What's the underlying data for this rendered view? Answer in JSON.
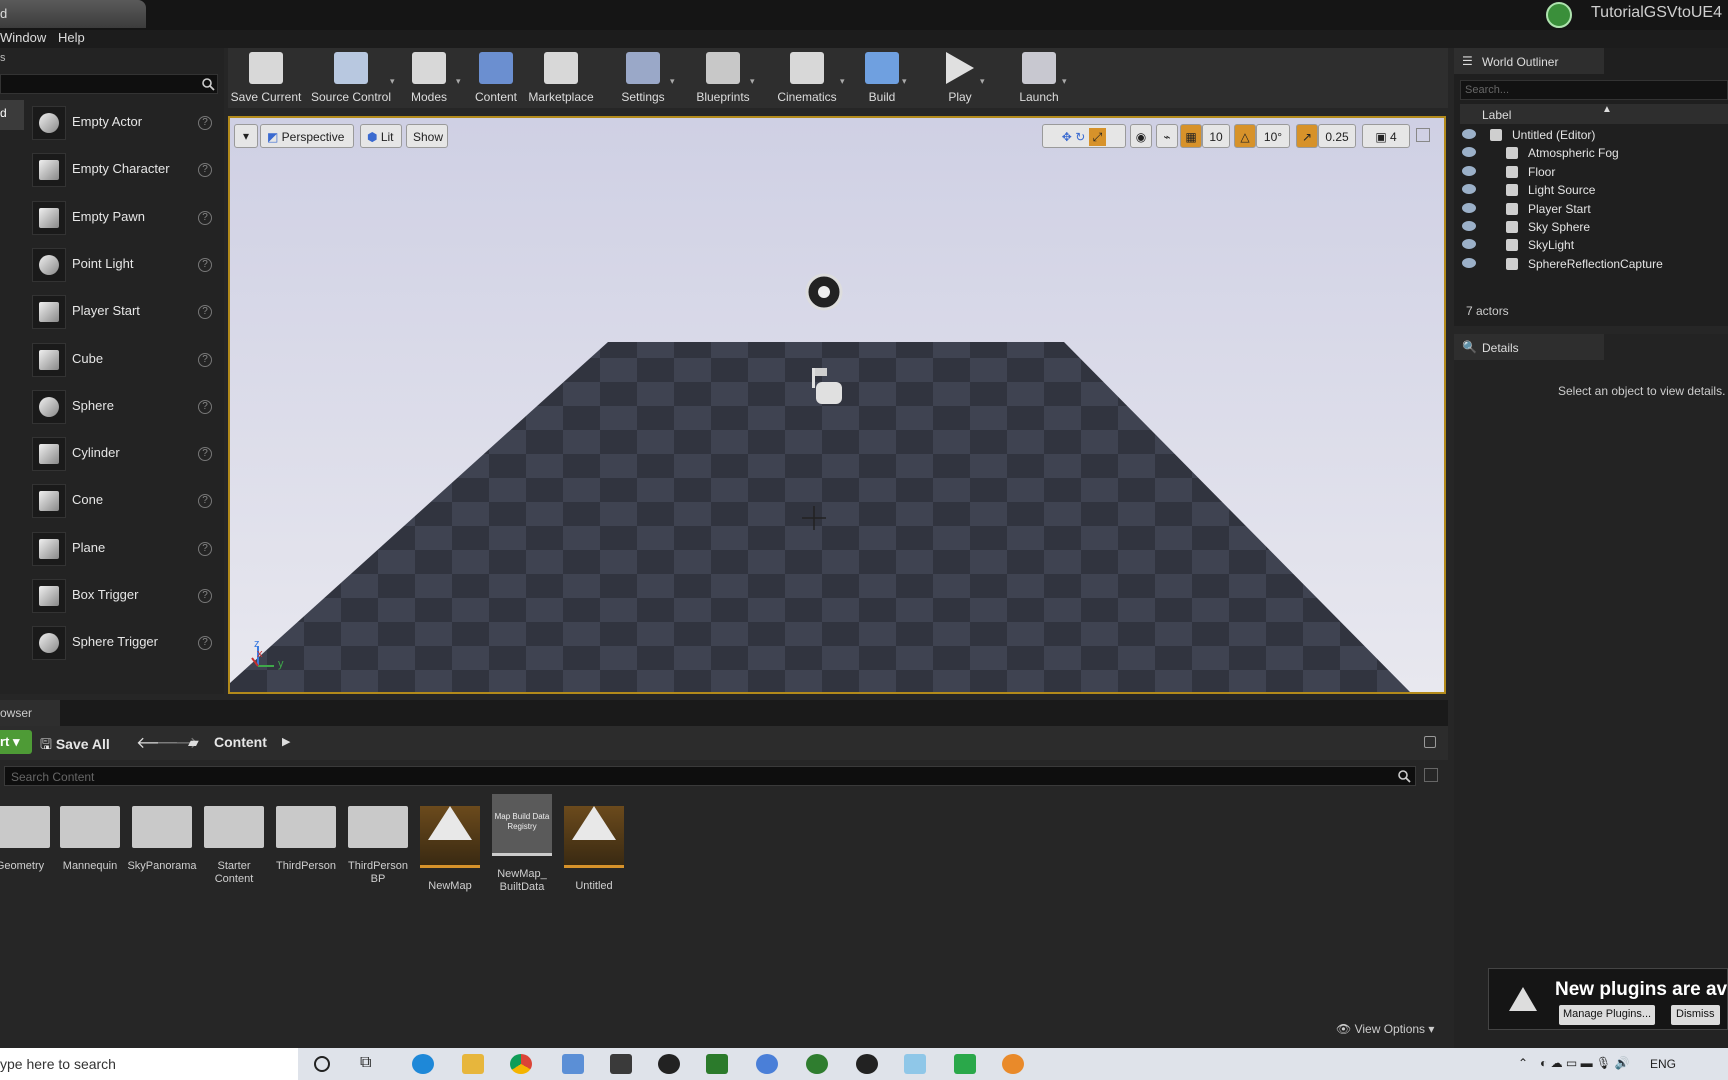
{
  "window": {
    "title_tab": "d",
    "project_name": "TutorialGSVtoUE4"
  },
  "menubar": {
    "items": [
      "Window",
      "Help"
    ]
  },
  "left_panel": {
    "header_fragment": "s",
    "category_fragment": "d",
    "items": [
      {
        "label": "Empty Actor",
        "icon": "empty-actor-icon"
      },
      {
        "label": "Empty Character",
        "icon": "character-icon"
      },
      {
        "label": "Empty Pawn",
        "icon": "pawn-icon"
      },
      {
        "label": "Point Light",
        "icon": "lightbulb-icon"
      },
      {
        "label": "Player Start",
        "icon": "player-start-icon"
      },
      {
        "label": "Cube",
        "icon": "cube-icon"
      },
      {
        "label": "Sphere",
        "icon": "sphere-icon"
      },
      {
        "label": "Cylinder",
        "icon": "cylinder-icon"
      },
      {
        "label": "Cone",
        "icon": "cone-icon"
      },
      {
        "label": "Plane",
        "icon": "plane-icon"
      },
      {
        "label": "Box Trigger",
        "icon": "box-trigger-icon"
      },
      {
        "label": "Sphere Trigger",
        "icon": "sphere-trigger-icon"
      }
    ]
  },
  "toolbar": {
    "buttons": [
      {
        "label": "Save Current",
        "icon": "save-icon"
      },
      {
        "label": "Source Control",
        "icon": "source-control-icon"
      },
      {
        "label": "Modes",
        "icon": "modes-icon"
      },
      {
        "label": "Content",
        "icon": "content-icon"
      },
      {
        "label": "Marketplace",
        "icon": "marketplace-icon"
      },
      {
        "label": "Settings",
        "icon": "settings-icon"
      },
      {
        "label": "Blueprints",
        "icon": "blueprints-icon"
      },
      {
        "label": "Cinematics",
        "icon": "cinematics-icon"
      },
      {
        "label": "Build",
        "icon": "build-icon"
      },
      {
        "label": "Play",
        "icon": "play-icon"
      },
      {
        "label": "Launch",
        "icon": "launch-icon"
      }
    ]
  },
  "viewport": {
    "perspective_label": "Perspective",
    "lit_label": "Lit",
    "show_label": "Show",
    "grid_snap": "10",
    "rotation_snap": "10°",
    "scale_snap": "0.25",
    "camera_speed": "4",
    "axis_z": "z",
    "axis_x": "x",
    "axis_y": "y",
    "accent_color": "#d7922a"
  },
  "content_browser": {
    "tab_label": "owser",
    "import_label": "rt",
    "save_all_label": "Save All",
    "path": "Content",
    "search_placeholder": "Search Content",
    "view_options": "View Options",
    "assets": [
      {
        "name": "Geometry",
        "type": "folder"
      },
      {
        "name": "Mannequin",
        "type": "folder"
      },
      {
        "name": "SkyPanorama",
        "type": "folder"
      },
      {
        "name": "Starter Content",
        "type": "folder"
      },
      {
        "name": "ThirdPerson",
        "type": "folder"
      },
      {
        "name": "ThirdPerson BP",
        "type": "folder"
      },
      {
        "name": "NewMap",
        "type": "map"
      },
      {
        "name": "NewMap_ BuiltData",
        "type": "registry",
        "thumb_text": "Map Build Data Registry"
      },
      {
        "name": "Untitled",
        "type": "map"
      }
    ]
  },
  "outliner": {
    "tab_label": "World Outliner",
    "search_placeholder": "Search...",
    "column_label": "Label",
    "rows": [
      {
        "label": "Untitled (Editor)",
        "indent": 0
      },
      {
        "label": "Atmospheric Fog",
        "indent": 1
      },
      {
        "label": "Floor",
        "indent": 1
      },
      {
        "label": "Light Source",
        "indent": 1
      },
      {
        "label": "Player Start",
        "indent": 1
      },
      {
        "label": "Sky Sphere",
        "indent": 1
      },
      {
        "label": "SkyLight",
        "indent": 1
      },
      {
        "label": "SphereReflectionCapture",
        "indent": 1
      }
    ],
    "actor_count": "7 actors"
  },
  "details": {
    "tab_label": "Details",
    "empty_message": "Select an object to view details."
  },
  "notification": {
    "title": "New plugins are av",
    "manage_label": "Manage Plugins...",
    "dismiss_label": "Dismiss"
  },
  "taskbar": {
    "search_placeholder": "ype here to search",
    "language": "ENG"
  }
}
